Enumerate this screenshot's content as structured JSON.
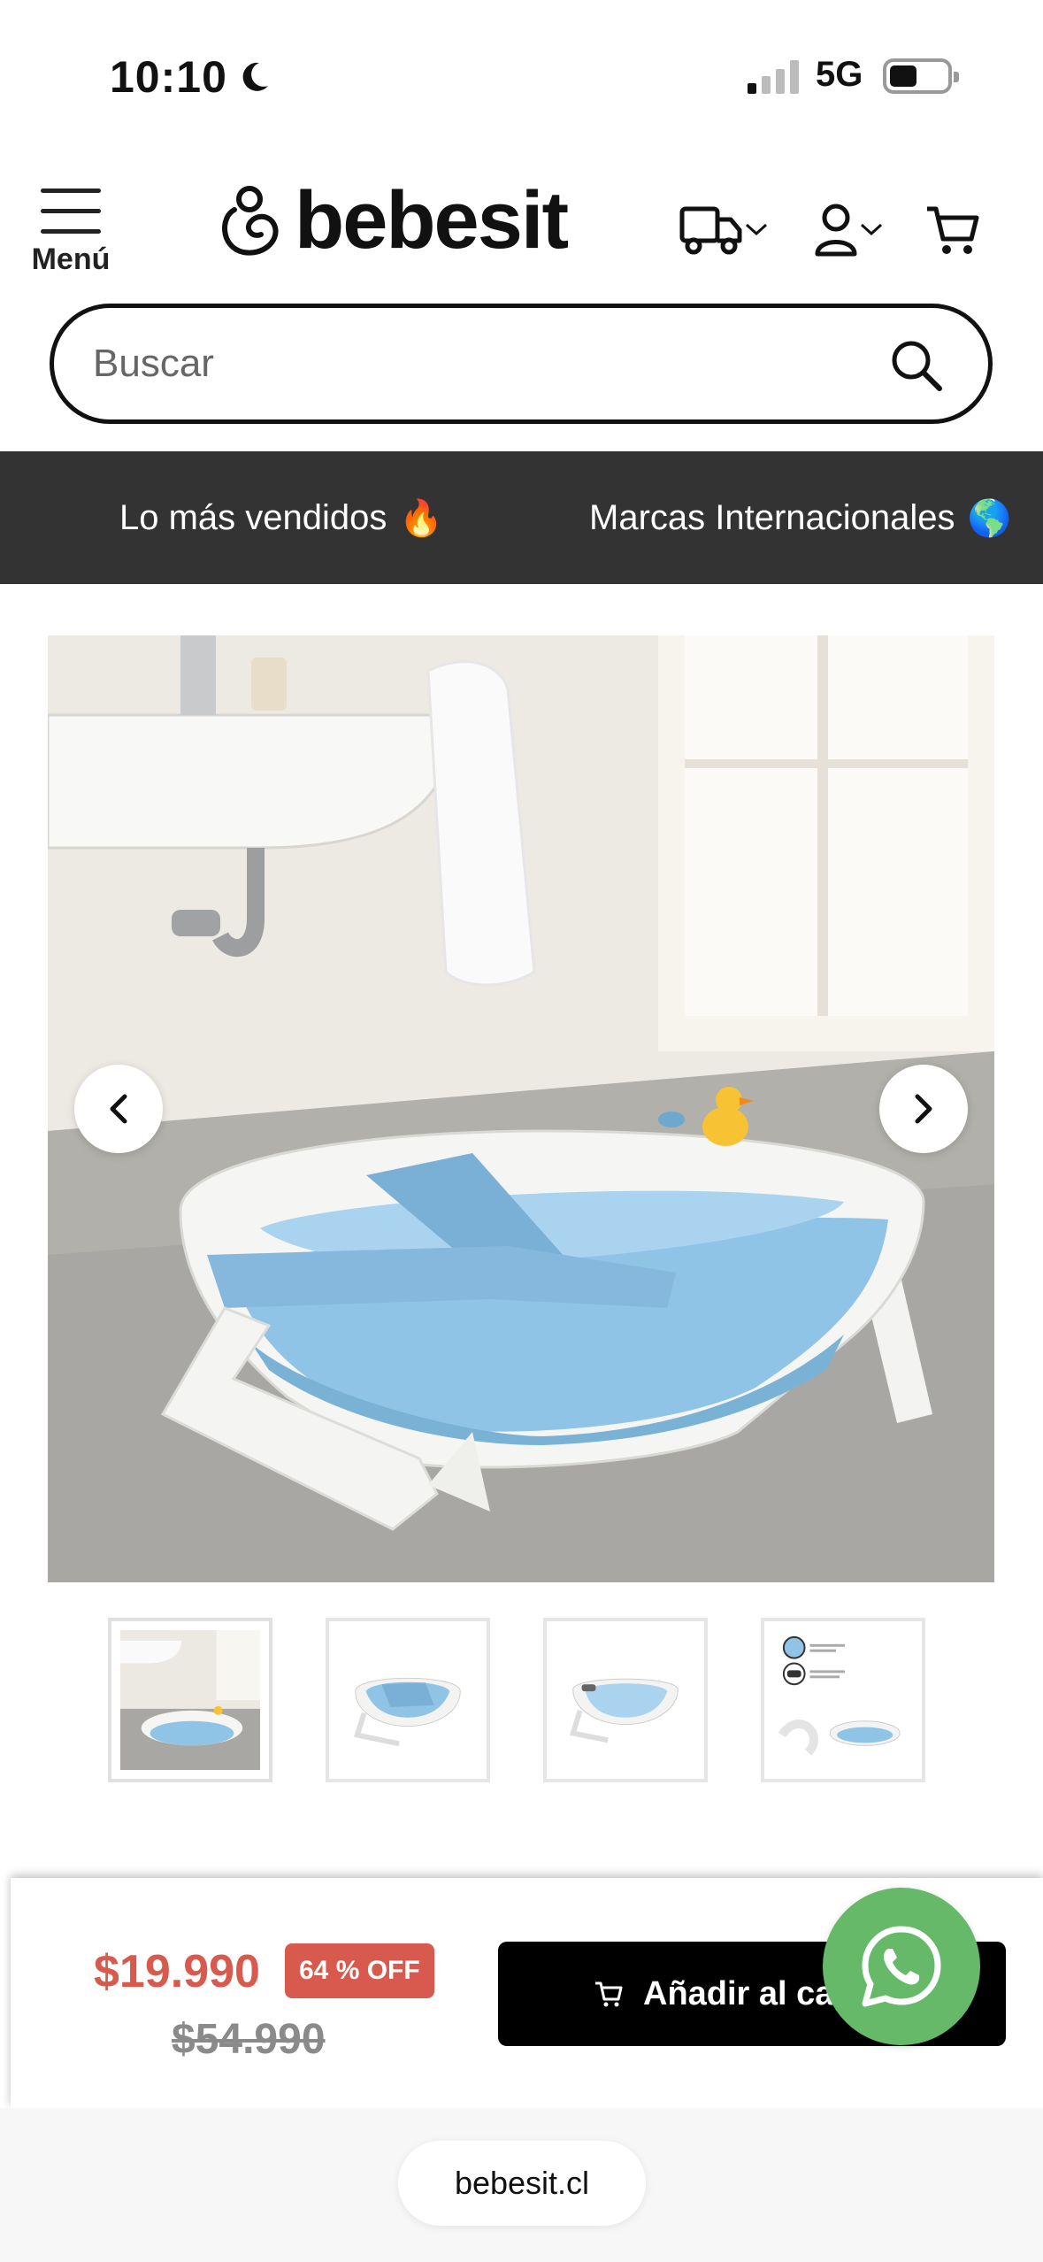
{
  "status_bar": {
    "time": "10:10",
    "network": "5G",
    "signal_bars": 1,
    "battery_level": 0.35
  },
  "header": {
    "menu_label": "Menú",
    "logo_text": "bebesit"
  },
  "search": {
    "placeholder": "Buscar"
  },
  "promo_nav": {
    "items": [
      {
        "label": "Lo más vendidos",
        "emoji": "🔥"
      },
      {
        "label": "Marcas Internacionales",
        "emoji": "🌎"
      }
    ]
  },
  "gallery": {
    "thumbnail_count": 4,
    "active_index": 0
  },
  "sticky_bar": {
    "price": "$19.990",
    "discount": "64 % OFF",
    "old_price": "$54.990",
    "add_button_label": "Añadir al carrito"
  },
  "browser": {
    "url": "bebesit.cl"
  },
  "colors": {
    "accent_price": "#d85a4f",
    "promo_nav_bg": "#333333",
    "whatsapp": "#67b96a",
    "tub_blue": "#8fc4e6"
  }
}
